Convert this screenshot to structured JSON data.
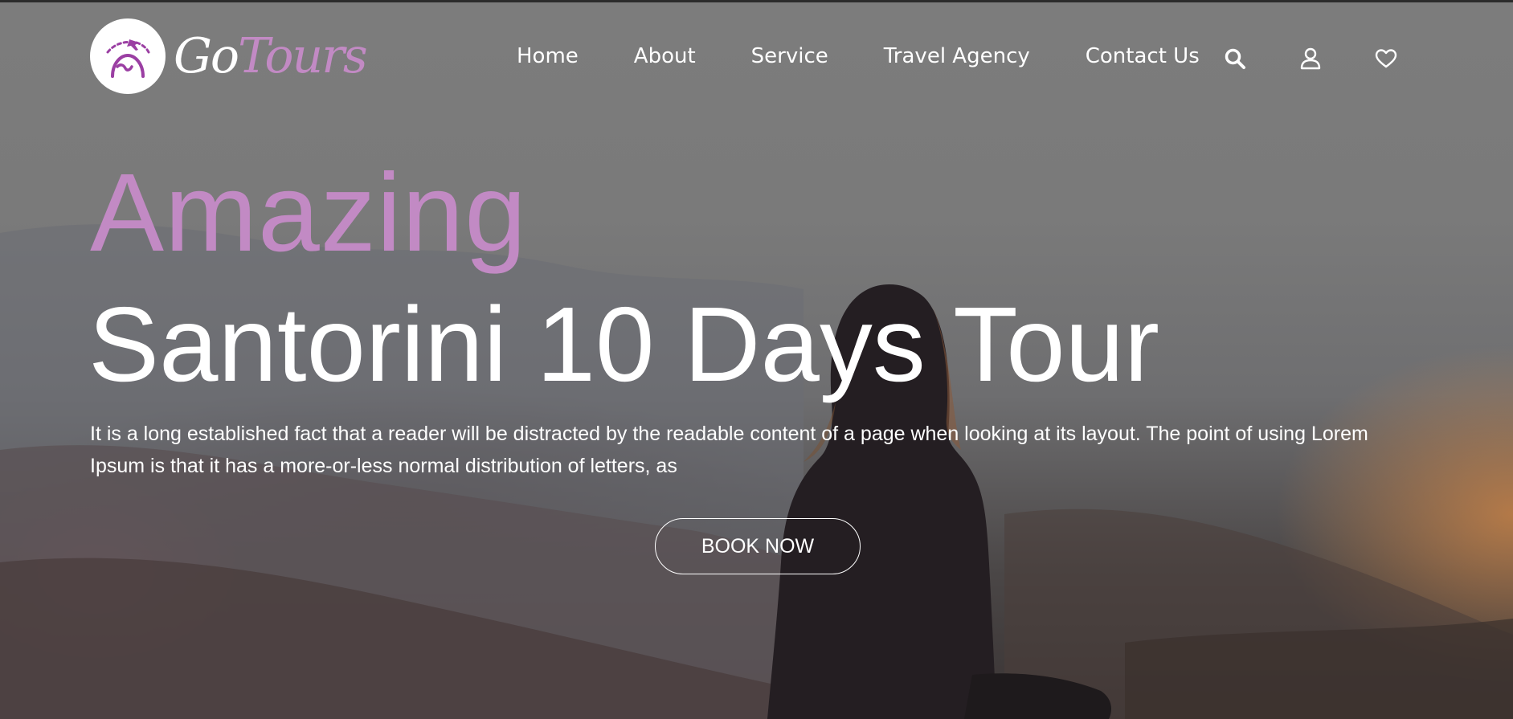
{
  "brand": {
    "name_part1": "Go",
    "name_part2": "Tours",
    "logo_icon": "airplane-globe-icon",
    "accent_color": "#c28ac4"
  },
  "nav": {
    "items": [
      {
        "label": "Home"
      },
      {
        "label": "About"
      },
      {
        "label": "Service"
      },
      {
        "label": "Travel Agency"
      },
      {
        "label": "Contact Us"
      }
    ],
    "icons": [
      "search-icon",
      "user-icon",
      "heart-icon"
    ]
  },
  "hero": {
    "eyebrow": "Amazing",
    "title": "Santorini 10 Days Tour",
    "description": "It is a long established fact that a reader will be distracted by the readable content of a page when looking at its layout. The point of using Lorem Ipsum is that it has a more-or-less normal distribution of letters, as",
    "cta_label": "BOOK NOW"
  }
}
